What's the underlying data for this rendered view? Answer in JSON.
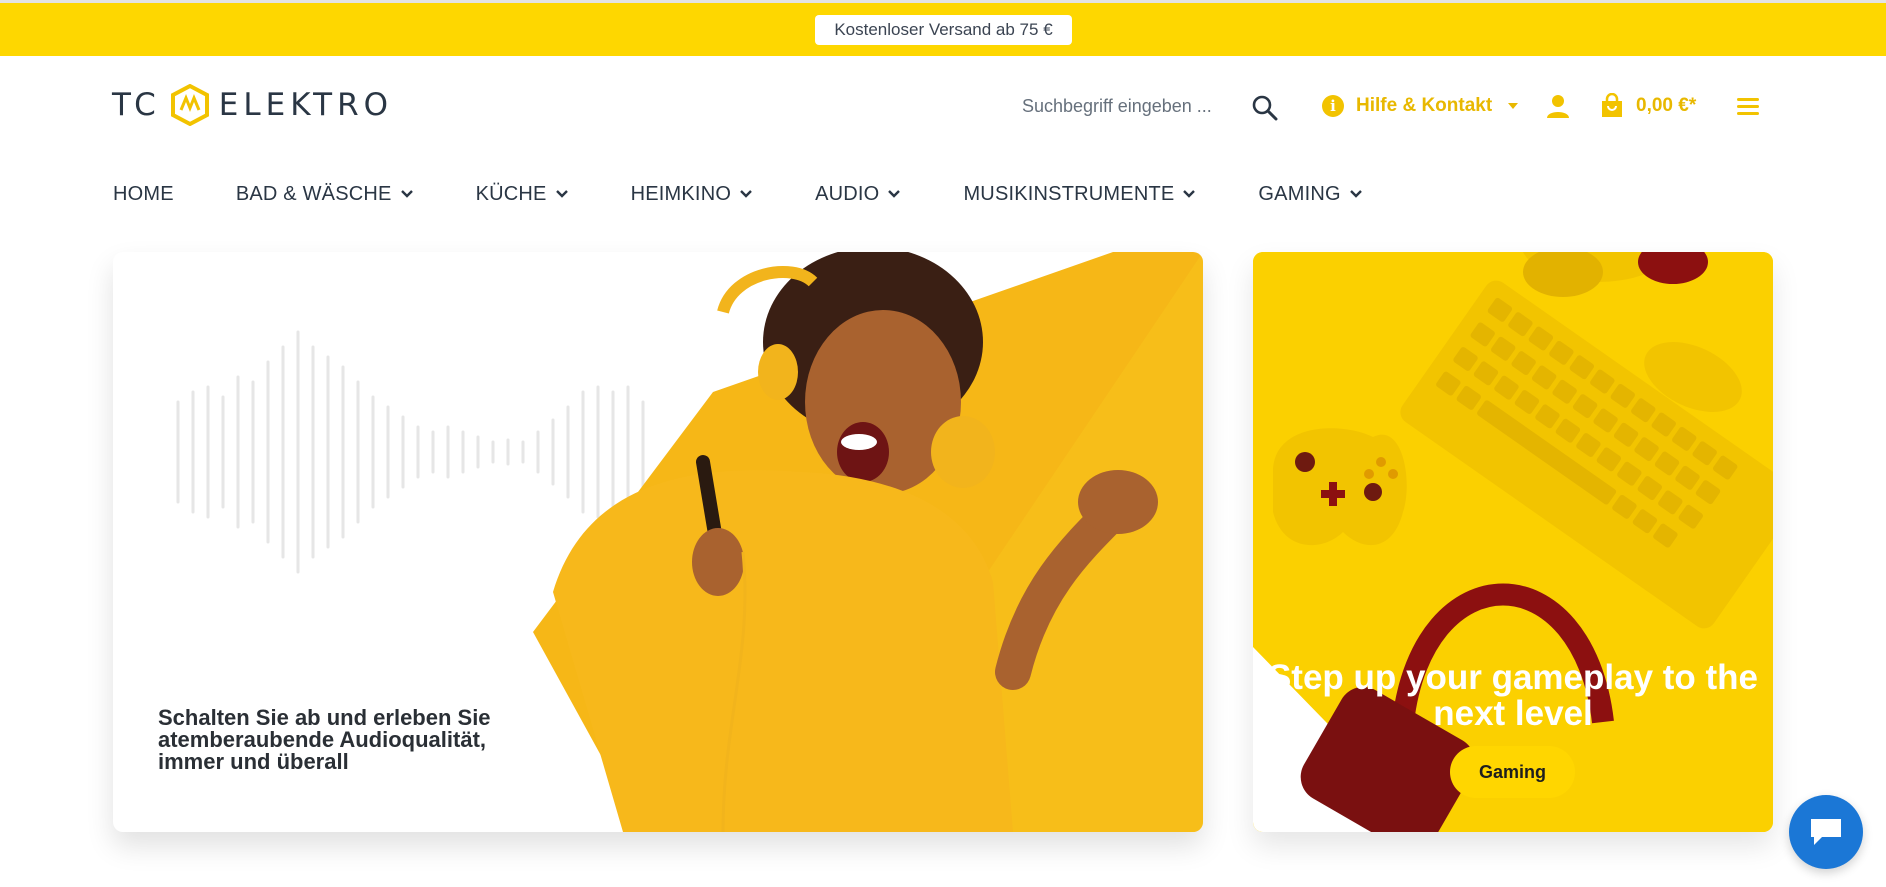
{
  "topbar": {
    "shipping_text": "Kostenloser Versand ab 75 €"
  },
  "header": {
    "logo_text": "TC ELEKTRO",
    "search": {
      "placeholder": "Suchbegriff eingeben ..."
    },
    "help_label": "Hilfe & Kontakt",
    "cart_total": "0,00 €*"
  },
  "nav": {
    "items": [
      {
        "label": "HOME"
      },
      {
        "label": "BAD & WÄSCHE"
      },
      {
        "label": "KÜCHE"
      },
      {
        "label": "HEIMKINO"
      },
      {
        "label": "AUDIO"
      },
      {
        "label": "MUSIKINSTRUMENTE"
      },
      {
        "label": "GAMING"
      }
    ]
  },
  "hero": {
    "text": "Schalten Sie ab und erleben Sie atemberaubende Audioqualität, immer und überall"
  },
  "promo": {
    "title": "Step up your gameplay to the next level",
    "button_label": "Gaming"
  },
  "colors": {
    "accent": "#fed700",
    "accent_text": "#e8b800",
    "text_dark": "#2a3644",
    "chat_blue": "#1b77d6"
  }
}
